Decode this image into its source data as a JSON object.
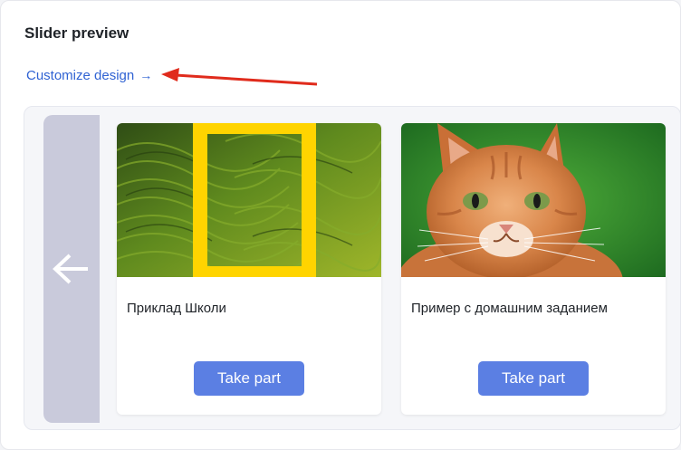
{
  "panel": {
    "title": "Slider preview"
  },
  "customize": {
    "label": "Customize design",
    "arrow": "→"
  },
  "slider": {
    "cards": [
      {
        "title": "Приклад Школи",
        "button": "Take part",
        "image": "terraced-landscape-with-yellow-frame-logo"
      },
      {
        "title": "Пример с домашним заданием",
        "button": "Take part",
        "image": "orange-tabby-cat-photo"
      }
    ]
  },
  "colors": {
    "link": "#2f62d3",
    "button": "#5b7fe3",
    "nav_bg": "#c9cadb",
    "annotation": "#e02b1c",
    "logo_yellow": "#ffd400"
  }
}
